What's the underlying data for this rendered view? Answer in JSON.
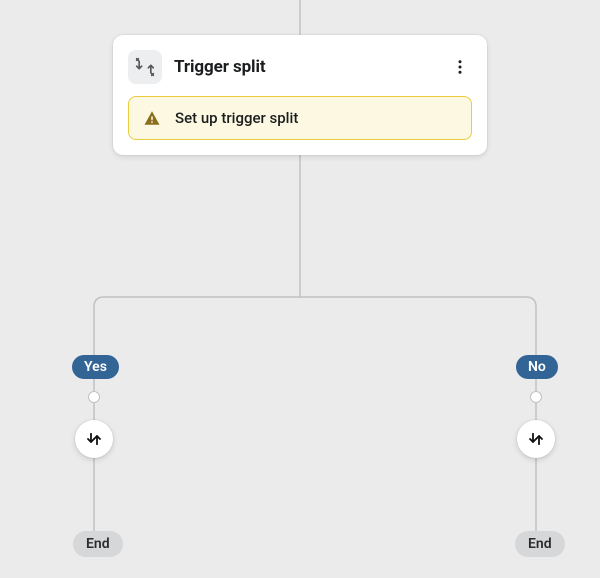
{
  "node": {
    "title": "Trigger split",
    "icon": "split-icon",
    "menu_icon": "more-vertical-icon",
    "alert": {
      "icon": "warning-icon",
      "text": "Set up trigger split"
    }
  },
  "branches": {
    "left": {
      "label": "Yes",
      "terminator": "End",
      "action_icon": "split-arrows-icon"
    },
    "right": {
      "label": "No",
      "terminator": "End",
      "action_icon": "split-arrows-icon"
    }
  },
  "colors": {
    "badge_bg": "#326496",
    "alert_bg": "#fdf8e1",
    "alert_border": "#eacd3e",
    "canvas_bg": "#ebebec",
    "end_bg": "#d6d7d8",
    "connector": "#c0c2c4"
  }
}
